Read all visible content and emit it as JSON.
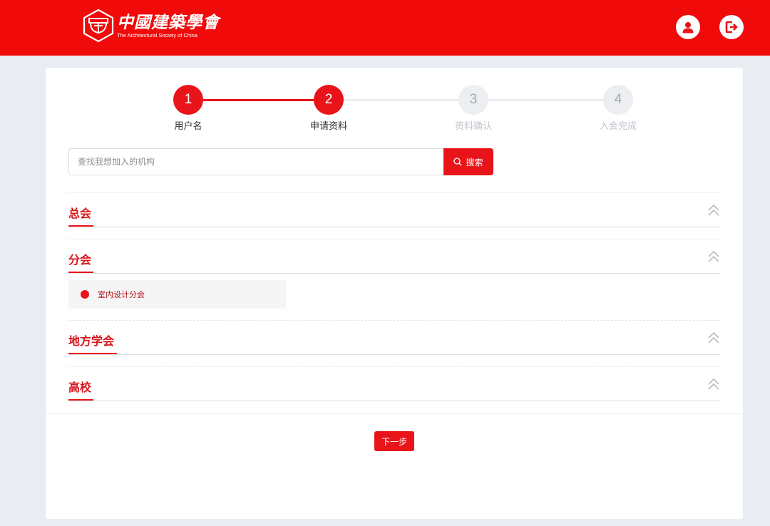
{
  "brand": {
    "name_cn": "中國建築學會",
    "name_en": "The Architectural Society of China"
  },
  "header": {
    "user_icon": "user-icon",
    "logout_icon": "logout-icon"
  },
  "colors": {
    "primary": "#e8141a",
    "header_bg": "#f00a0a",
    "inactive_circle": "#eceef1",
    "page_bg": "#e9ecf2"
  },
  "steps": [
    {
      "number": "1",
      "label": "用户名",
      "state": "done"
    },
    {
      "number": "2",
      "label": "申请资料",
      "state": "current"
    },
    {
      "number": "3",
      "label": "资料确认",
      "state": "pending"
    },
    {
      "number": "4",
      "label": "入会完成",
      "state": "pending"
    }
  ],
  "search": {
    "placeholder": "查找我想加入的机构",
    "value": "",
    "button_label": "搜索",
    "button_icon": "search-icon"
  },
  "sections": [
    {
      "title": "总会",
      "expanded_icon": "chevron-double-up-icon",
      "items": []
    },
    {
      "title": "分会",
      "expanded_icon": "chevron-double-up-icon",
      "items": [
        "室内设计分会"
      ]
    },
    {
      "title": "地方学会",
      "expanded_icon": "chevron-double-up-icon",
      "items": []
    },
    {
      "title": "高校",
      "expanded_icon": "chevron-double-up-icon",
      "items": []
    }
  ],
  "actions": {
    "next_label": "下一步"
  }
}
